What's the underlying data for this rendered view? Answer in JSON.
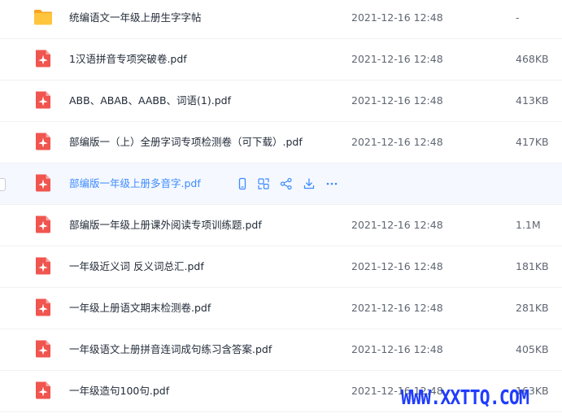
{
  "files": [
    {
      "name": "统编语文一年级上册生字字帖",
      "time": "2021-12-16 12:48",
      "size": "-",
      "icon": "folder-icon"
    },
    {
      "name": "1汉语拼音专项突破卷.pdf",
      "time": "2021-12-16 12:48",
      "size": "468KB",
      "icon": "pdf-icon"
    },
    {
      "name": "ABB、ABAB、AABB、词语(1).pdf",
      "time": "2021-12-16 12:48",
      "size": "413KB",
      "icon": "pdf-icon"
    },
    {
      "name": "部编版一（上）全册字词专项检测卷（可下载）.pdf",
      "time": "2021-12-16 12:48",
      "size": "417KB",
      "icon": "pdf-icon"
    },
    {
      "name": "部编版一年级上册多音字.pdf",
      "time": "",
      "size": "",
      "icon": "pdf-icon",
      "hovered": true
    },
    {
      "name": "部编版一年级上册课外阅读专项训练题.pdf",
      "time": "2021-12-16 12:48",
      "size": "1.1M",
      "icon": "pdf-icon"
    },
    {
      "name": "一年级近义词 反义词总汇.pdf",
      "time": "2021-12-16 12:48",
      "size": "181KB",
      "icon": "pdf-icon"
    },
    {
      "name": "一年级上册语文期末检测卷.pdf",
      "time": "2021-12-16 12:48",
      "size": "281KB",
      "icon": "pdf-icon"
    },
    {
      "name": "一年级语文上册拼音连词成句练习含答案.pdf",
      "time": "2021-12-16 12:48",
      "size": "405KB",
      "icon": "pdf-icon"
    },
    {
      "name": "一年级造句100句.pdf",
      "time": "2021-12-16 12:48",
      "size": "163KB",
      "icon": "pdf-icon"
    }
  ],
  "hover_actions": [
    "phone-icon",
    "copy-icon",
    "share-icon",
    "download-icon",
    "more-icon"
  ],
  "watermark": "WWW.XXTTQ.COM",
  "colors": {
    "accent": "#3d8bfd",
    "pdf": "#f0554f",
    "folder": "#ffc53d",
    "watermark": "#1f3cff"
  }
}
